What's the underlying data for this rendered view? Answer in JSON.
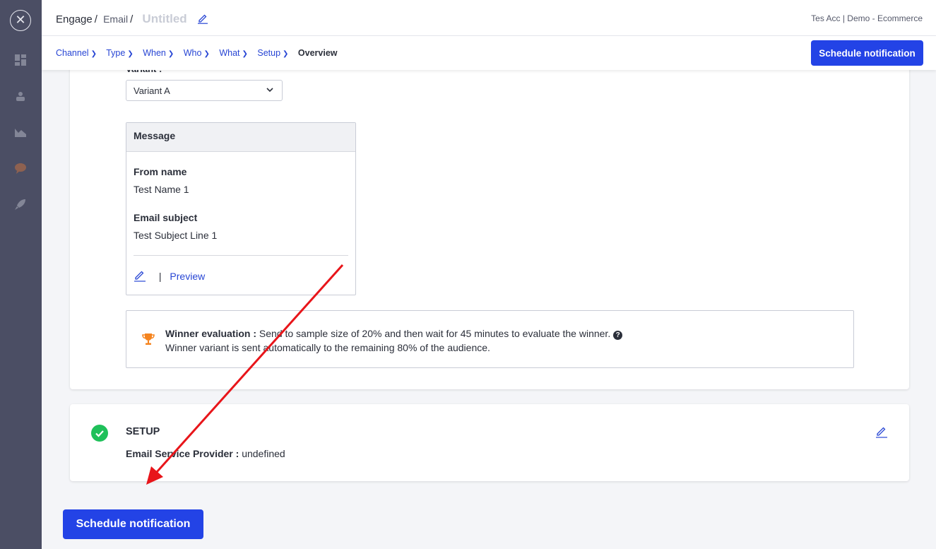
{
  "rail": {
    "close_icon": "close-icon"
  },
  "header": {
    "crumb_engage": "Engage",
    "crumb_email": "Email",
    "crumb_separator": "/",
    "campaign_name": "Untitled",
    "account": "Tes Acc | Demo - Ecommerce"
  },
  "steps": [
    {
      "label": "Channel"
    },
    {
      "label": "Type"
    },
    {
      "label": "When"
    },
    {
      "label": "Who"
    },
    {
      "label": "What"
    },
    {
      "label": "Setup"
    },
    {
      "label": "Overview"
    }
  ],
  "schedule_button": "Schedule notification",
  "variant": {
    "label": "Variant :",
    "selected": "Variant A"
  },
  "message": {
    "heading": "Message",
    "from_name_label": "From name",
    "from_name_value": "Test Name 1",
    "subject_label": "Email subject",
    "subject_value": "Test Subject Line 1",
    "separator": "|",
    "preview_label": "Preview"
  },
  "winner": {
    "label": "Winner evaluation :",
    "line1": "Send to sample size of 20% and then wait for 45 minutes to evaluate the winner.",
    "line2": "Winner variant is sent automatically to the remaining 80% of the audience.",
    "help": "?"
  },
  "setup": {
    "title": "SETUP",
    "esp_label": "Email Service Provider :",
    "esp_value": "undefined"
  },
  "colors": {
    "primary": "#2343e6",
    "link": "#2745d4",
    "success": "#1fc05a",
    "trophy": "#f5841f",
    "annotation_arrow": "#e8151a",
    "rail": "#4b4e64"
  }
}
